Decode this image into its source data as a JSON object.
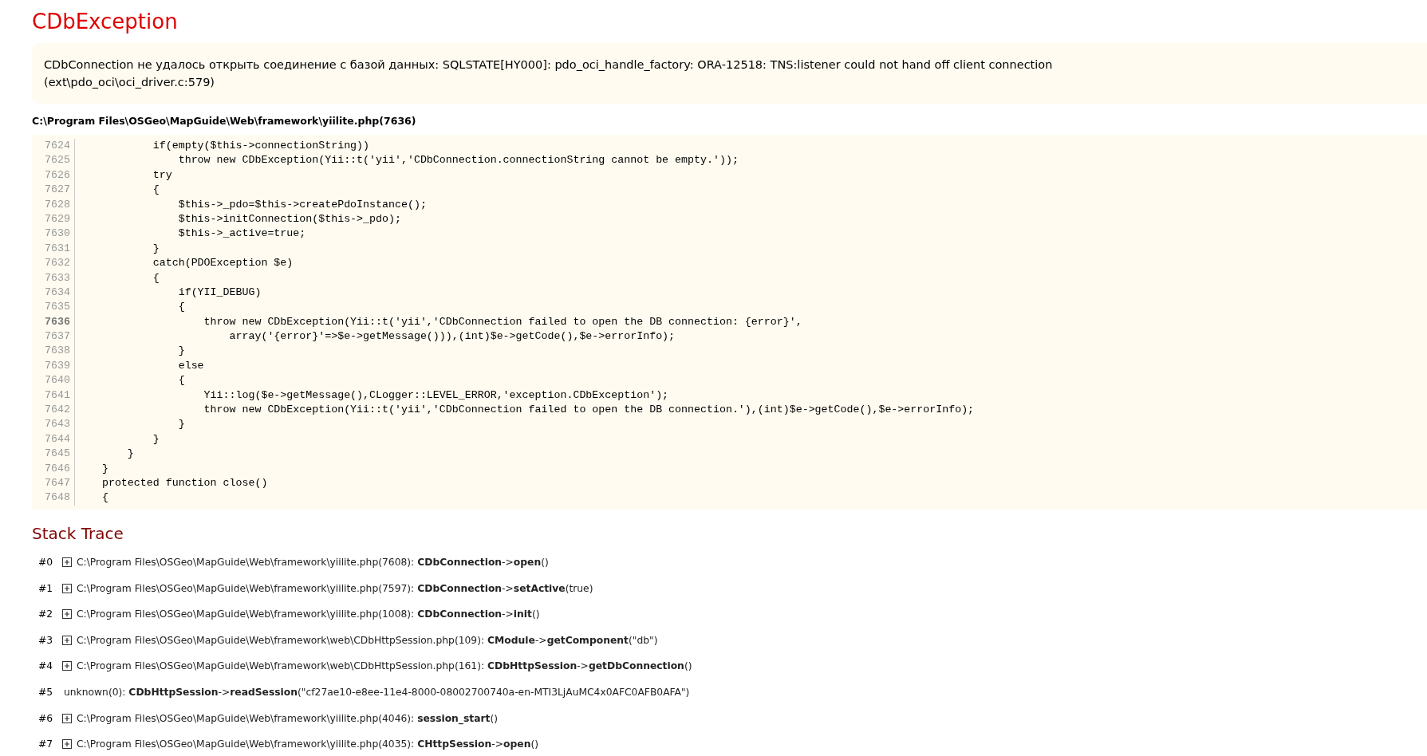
{
  "title": "CDbException",
  "message": {
    "line_1": "CDbConnection не удалось открыть соединение с базой данных: SQLSTATE[HY000]: pdo_oci_handle_factory: ORA-12518: TNS:listener could not hand off client connection",
    "line_2": "(ext\\pdo_oci\\oci_driver.c:579)"
  },
  "source_file": "C:\\Program Files\\OSGeo\\MapGuide\\Web\\framework\\yiilite.php(7636)",
  "code_lines": [
    {
      "number": "7624",
      "code": "            if(empty($this->connectionString))",
      "highlighted": false
    },
    {
      "number": "7625",
      "code": "                throw new CDbException(Yii::t('yii','CDbConnection.connectionString cannot be empty.'));",
      "highlighted": false
    },
    {
      "number": "7626",
      "code": "            try",
      "highlighted": false
    },
    {
      "number": "7627",
      "code": "            {",
      "highlighted": false
    },
    {
      "number": "7628",
      "code": "                $this->_pdo=$this->createPdoInstance();",
      "highlighted": false
    },
    {
      "number": "7629",
      "code": "                $this->initConnection($this->_pdo);",
      "highlighted": false
    },
    {
      "number": "7630",
      "code": "                $this->_active=true;",
      "highlighted": false
    },
    {
      "number": "7631",
      "code": "            }",
      "highlighted": false
    },
    {
      "number": "7632",
      "code": "            catch(PDOException $e)",
      "highlighted": false
    },
    {
      "number": "7633",
      "code": "            {",
      "highlighted": false
    },
    {
      "number": "7634",
      "code": "                if(YII_DEBUG)",
      "highlighted": false
    },
    {
      "number": "7635",
      "code": "                {",
      "highlighted": false
    },
    {
      "number": "7636",
      "code": "                    throw new CDbException(Yii::t('yii','CDbConnection failed to open the DB connection: {error}',",
      "highlighted": true
    },
    {
      "number": "7637",
      "code": "                        array('{error}'=>$e->getMessage())),(int)$e->getCode(),$e->errorInfo);",
      "highlighted": false
    },
    {
      "number": "7638",
      "code": "                }",
      "highlighted": false
    },
    {
      "number": "7639",
      "code": "                else",
      "highlighted": false
    },
    {
      "number": "7640",
      "code": "                {",
      "highlighted": false
    },
    {
      "number": "7641",
      "code": "                    Yii::log($e->getMessage(),CLogger::LEVEL_ERROR,'exception.CDbException');",
      "highlighted": false
    },
    {
      "number": "7642",
      "code": "                    throw new CDbException(Yii::t('yii','CDbConnection failed to open the DB connection.'),(int)$e->getCode(),$e->errorInfo);",
      "highlighted": false
    },
    {
      "number": "7643",
      "code": "                }",
      "highlighted": false
    },
    {
      "number": "7644",
      "code": "            }",
      "highlighted": false
    },
    {
      "number": "7645",
      "code": "        }",
      "highlighted": false
    },
    {
      "number": "7646",
      "code": "    }",
      "highlighted": false
    },
    {
      "number": "7647",
      "code": "    protected function close()",
      "highlighted": false
    },
    {
      "number": "7648",
      "code": "    {",
      "highlighted": false
    }
  ],
  "stack_trace": {
    "heading": "Stack Trace",
    "frames": [
      {
        "index": "#0",
        "expandable": true,
        "text": "C:\\Program Files\\OSGeo\\MapGuide\\Web\\framework\\yiilite.php(7608): **CDbConnection**->**open**()"
      },
      {
        "index": "#1",
        "expandable": true,
        "text": "C:\\Program Files\\OSGeo\\MapGuide\\Web\\framework\\yiilite.php(7597): **CDbConnection**->**setActive**(true)"
      },
      {
        "index": "#2",
        "expandable": true,
        "text": "C:\\Program Files\\OSGeo\\MapGuide\\Web\\framework\\yiilite.php(1008): **CDbConnection**->**init**()"
      },
      {
        "index": "#3",
        "expandable": true,
        "text": "C:\\Program Files\\OSGeo\\MapGuide\\Web\\framework\\web\\CDbHttpSession.php(109): **CModule**->**getComponent**(\"db\")"
      },
      {
        "index": "#4",
        "expandable": true,
        "text": "C:\\Program Files\\OSGeo\\MapGuide\\Web\\framework\\web\\CDbHttpSession.php(161): **CDbHttpSession**->**getDbConnection**()"
      },
      {
        "index": "#5",
        "expandable": false,
        "text": "unknown(0): **CDbHttpSession**->**readSession**(\"cf27ae10-e8ee-11e4-8000-08002700740a-en-MTI3LjAuMC4x0AFC0AFB0AFA\")"
      },
      {
        "index": "#6",
        "expandable": true,
        "text": "C:\\Program Files\\OSGeo\\MapGuide\\Web\\framework\\yiilite.php(4046): **session_start**()"
      },
      {
        "index": "#7",
        "expandable": true,
        "text": "C:\\Program Files\\OSGeo\\MapGuide\\Web\\framework\\yiilite.php(4035): **CHttpSession**->**open**()"
      }
    ]
  }
}
